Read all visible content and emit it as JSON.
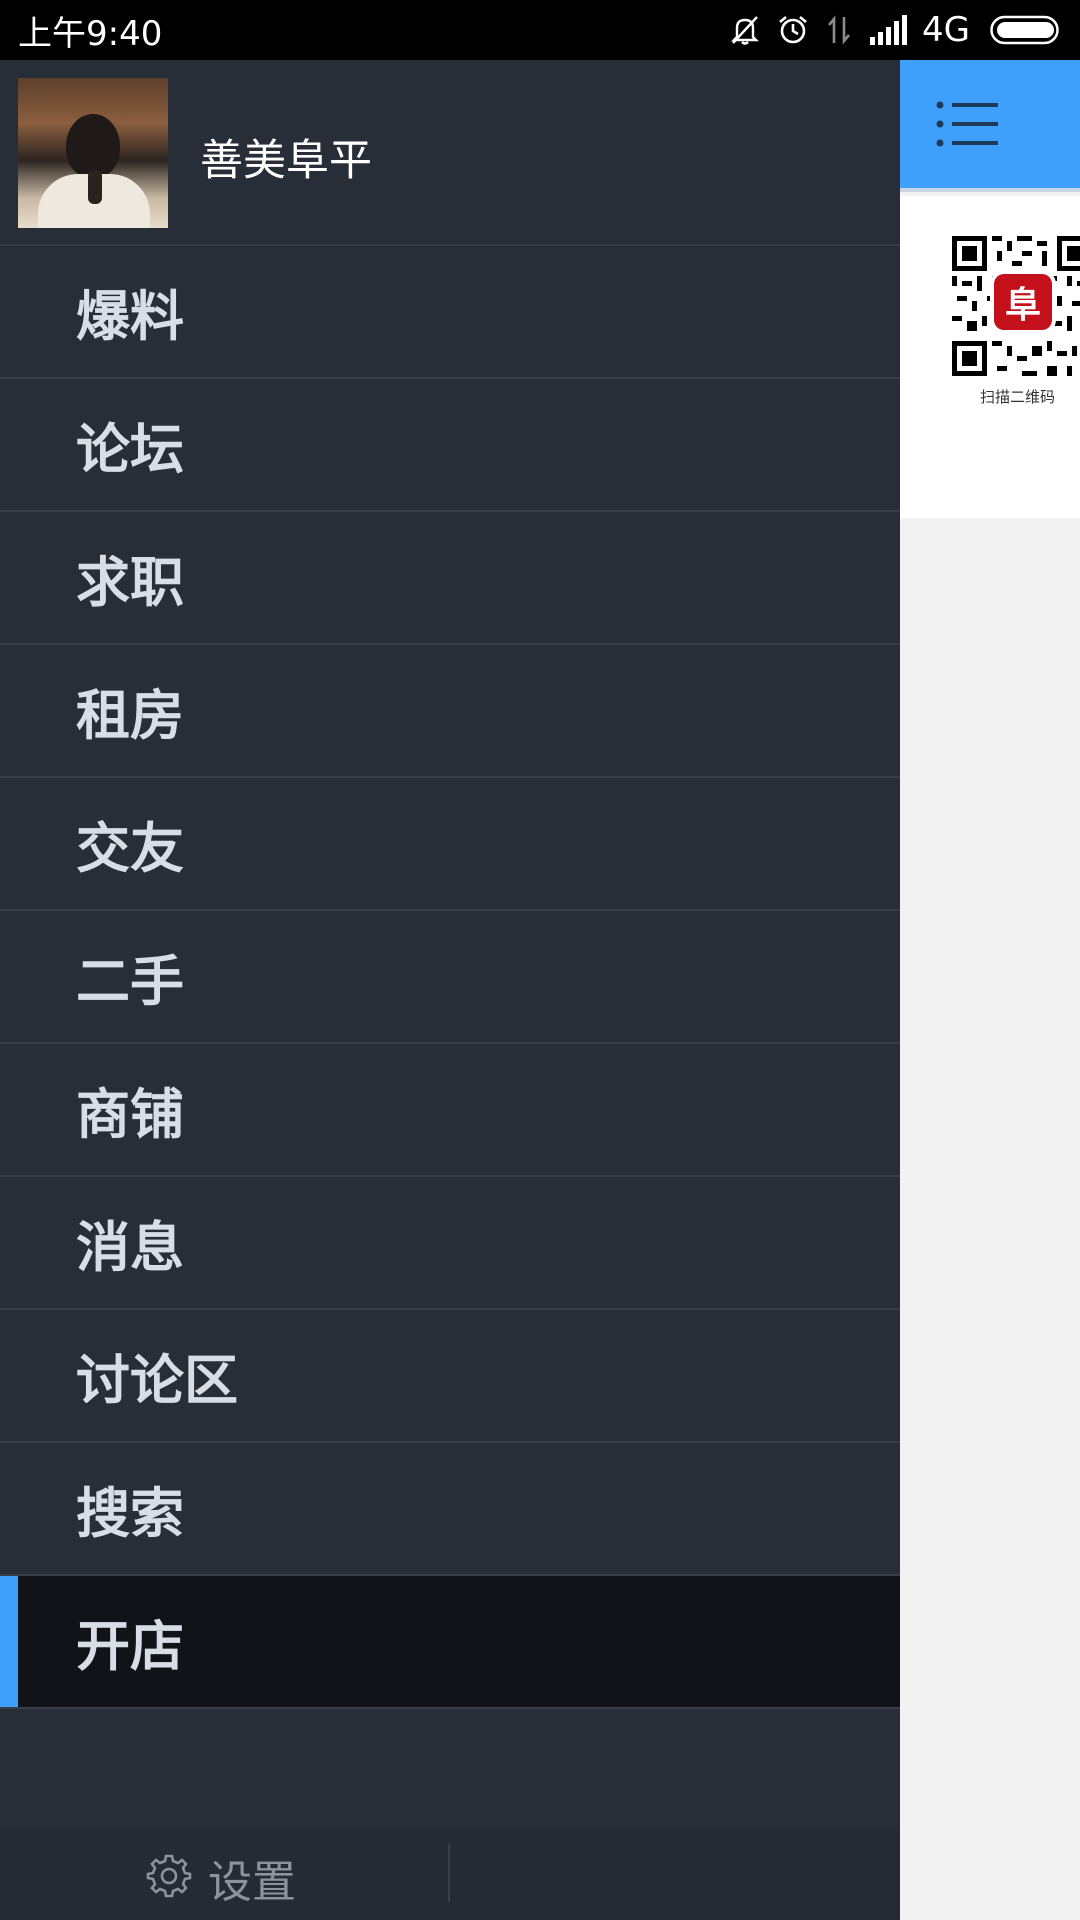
{
  "status_bar": {
    "time": "上午9:40",
    "network": "4G",
    "icons": [
      "bell-off-icon",
      "alarm-icon",
      "data-arrows-icon",
      "signal-icon",
      "battery-icon"
    ]
  },
  "drawer": {
    "profile": {
      "username": "善美阜平",
      "avatar": "avatar"
    },
    "menu": [
      {
        "label": "爆料",
        "active": false
      },
      {
        "label": "论坛",
        "active": false
      },
      {
        "label": "求职",
        "active": false
      },
      {
        "label": "租房",
        "active": false
      },
      {
        "label": "交友",
        "active": false
      },
      {
        "label": "二手",
        "active": false
      },
      {
        "label": "商铺",
        "active": false
      },
      {
        "label": "消息",
        "active": false
      },
      {
        "label": "讨论区",
        "active": false
      },
      {
        "label": "搜索",
        "active": false
      },
      {
        "label": "开店",
        "active": true
      }
    ],
    "footer": {
      "settings_label": "设置",
      "settings_icon": "gear-icon"
    }
  },
  "background_app": {
    "header_color": "#3fa0fb",
    "menu_icon": "list-icon",
    "qr_badge": "阜",
    "qr_caption": "扫描二维码"
  },
  "colors": {
    "accent": "#3fa0fb",
    "drawer_bg": "#282e37",
    "active_item_bg": "#111318"
  }
}
